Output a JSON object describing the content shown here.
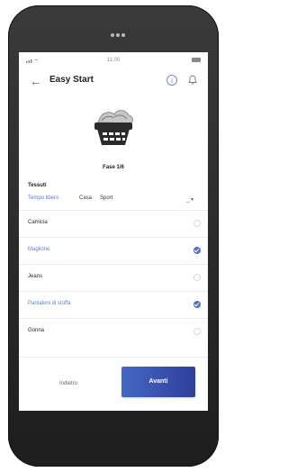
{
  "status_bar": {
    "time": "11:00"
  },
  "header": {
    "title": "Easy Start",
    "info_label": "i"
  },
  "phase": {
    "label": "Fase 1/6"
  },
  "section": {
    "title": "Tessuti"
  },
  "tabs": [
    {
      "label": "Tempo libero",
      "active": true
    },
    {
      "label": "Casa",
      "active": false
    },
    {
      "label": "Sport",
      "active": false
    }
  ],
  "tabs_dropdown": {
    "label": "_ ▾"
  },
  "items": [
    {
      "label": "Camicia",
      "selected": false
    },
    {
      "label": "Maglione",
      "selected": true
    },
    {
      "label": "Jeans",
      "selected": false
    },
    {
      "label": "Pantaloni di stoffa",
      "selected": true
    },
    {
      "label": "Gonna",
      "selected": false
    }
  ],
  "buttons": {
    "back": "Indietro",
    "next": "Avanti"
  },
  "colors": {
    "accent": "#5d7ed0",
    "primary_button_start": "#4468c4",
    "primary_button_end": "#2f3f9a",
    "phone_body": "#242424"
  },
  "icons": {
    "back": "arrow-left-icon",
    "info": "info-icon",
    "bell": "bell-icon",
    "basket": "laundry-basket-icon",
    "checked": "check-icon"
  }
}
